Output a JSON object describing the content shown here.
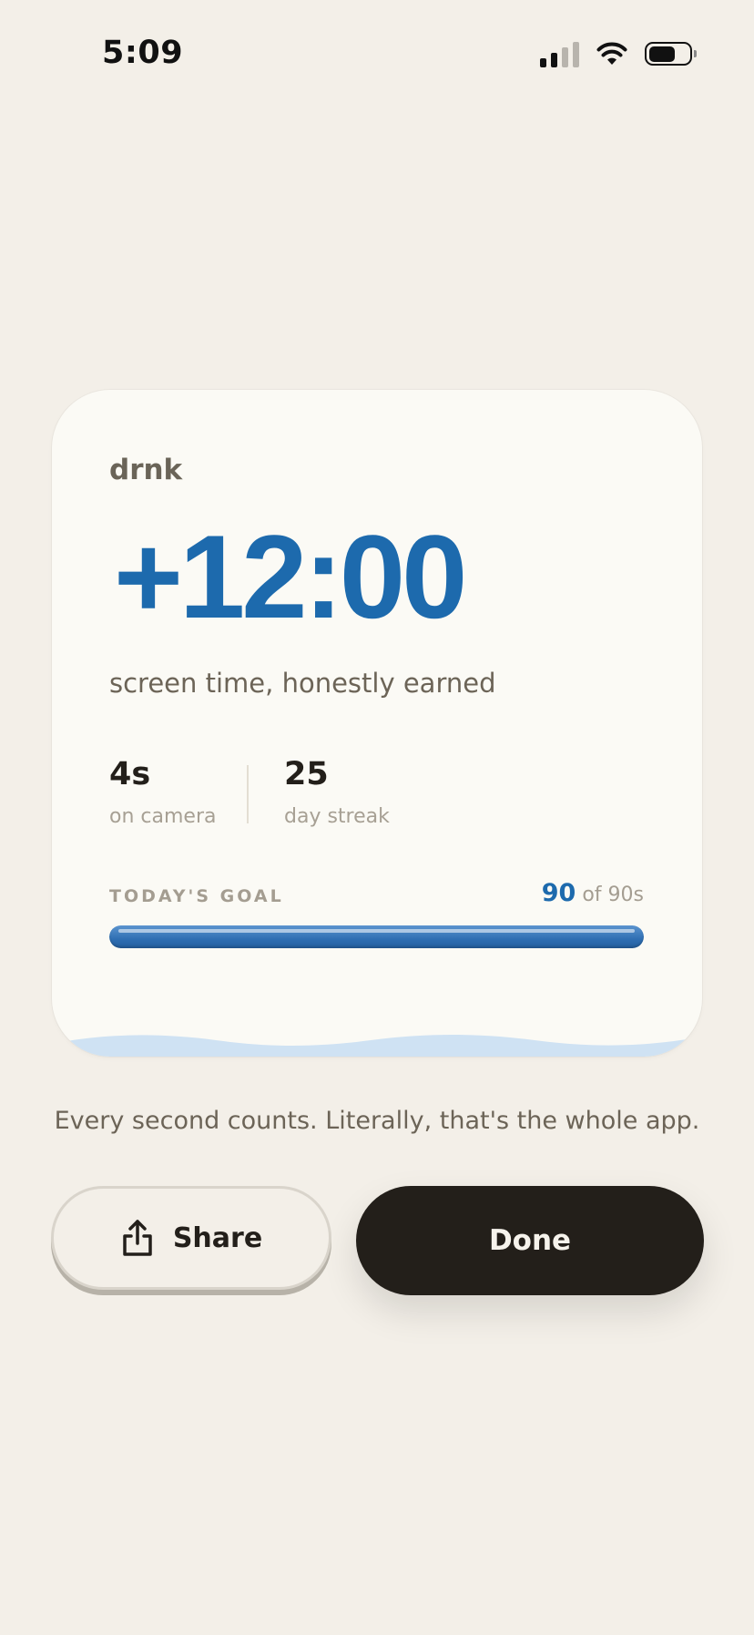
{
  "status_bar": {
    "time": "5:09",
    "battery_level": 0.7
  },
  "card": {
    "brand": "drnk",
    "earned_time": "+12:00",
    "subtitle": "screen time, honestly earned",
    "stats": [
      {
        "value": "4s",
        "label": "on camera"
      },
      {
        "value": "25",
        "label": "day streak"
      }
    ],
    "goal": {
      "label": "TODAY'S GOAL",
      "current": "90",
      "of_text": "of 90s",
      "progress_fraction": 1.0
    }
  },
  "caption": "Every second counts. Literally, that's the whole app.",
  "buttons": {
    "share_label": "Share",
    "done_label": "Done"
  },
  "colors": {
    "background": "#f3efe8",
    "card": "#fbfaf5",
    "accent_blue": "#1d6aad",
    "dark": "#231f1a",
    "wave": "#cfe2f3"
  },
  "icons": {
    "share": "share-icon",
    "signal": "cellular-signal-icon",
    "wifi": "wifi-icon",
    "battery": "battery-icon"
  }
}
